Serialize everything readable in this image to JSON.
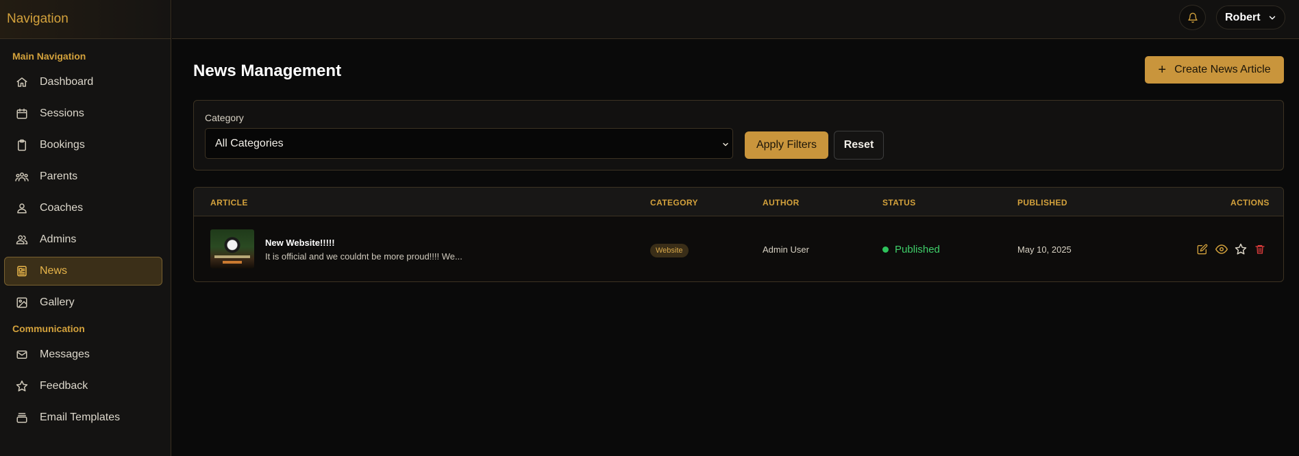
{
  "sidebar": {
    "title": "Navigation",
    "sections": [
      {
        "label": "Main Navigation",
        "items": [
          {
            "label": "Dashboard",
            "icon": "home-icon"
          },
          {
            "label": "Sessions",
            "icon": "calendar-icon"
          },
          {
            "label": "Bookings",
            "icon": "clipboard-icon"
          },
          {
            "label": "Parents",
            "icon": "users-icon"
          },
          {
            "label": "Coaches",
            "icon": "user-icon"
          },
          {
            "label": "Admins",
            "icon": "user-group-icon"
          },
          {
            "label": "News",
            "icon": "newspaper-icon",
            "active": true
          },
          {
            "label": "Gallery",
            "icon": "image-icon"
          }
        ]
      },
      {
        "label": "Communication",
        "items": [
          {
            "label": "Messages",
            "icon": "mail-icon"
          },
          {
            "label": "Feedback",
            "icon": "star-icon"
          },
          {
            "label": "Email Templates",
            "icon": "inbox-icon"
          }
        ]
      }
    ]
  },
  "topbar": {
    "user_name": "Robert",
    "bell_icon": "bell-icon"
  },
  "main": {
    "title": "News Management",
    "create_button": "Create News Article",
    "filters": {
      "category_label": "Category",
      "category_value": "All Categories",
      "apply_label": "Apply Filters",
      "reset_label": "Reset"
    },
    "table": {
      "columns": [
        "ARTICLE",
        "CATEGORY",
        "AUTHOR",
        "STATUS",
        "PUBLISHED",
        "ACTIONS"
      ],
      "rows": [
        {
          "title": "New Website!!!!!",
          "excerpt": "It is official and we couldnt be more proud!!!! We...",
          "category": "Website",
          "author": "Admin User",
          "status": "Published",
          "published": "May 10, 2025"
        }
      ]
    }
  },
  "colors": {
    "accent": "#c9953c",
    "accent_text": "#d4a23c",
    "status_published": "#3fcf6a",
    "delete": "#e03c3c"
  }
}
